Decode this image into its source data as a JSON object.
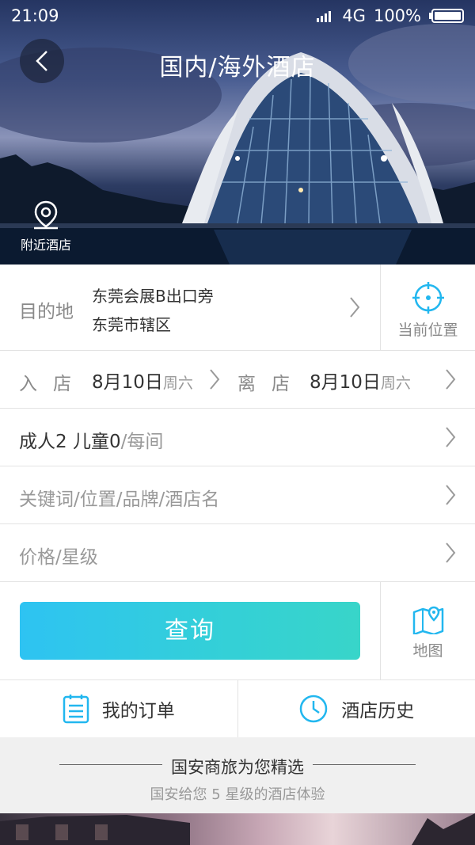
{
  "status": {
    "time": "21:09",
    "network": "4G",
    "battery": "100%"
  },
  "header": {
    "title": "国内/海外酒店",
    "nearby_label": "附近酒店"
  },
  "destination": {
    "label": "目的地",
    "line1": "东莞会展B出口旁",
    "line2": "东莞市辖区",
    "current_location": "当前位置"
  },
  "dates": {
    "checkin_label": "入店",
    "checkin_date": "8月10日",
    "checkin_weekday": "周六",
    "checkout_label": "离店",
    "checkout_date": "8月10日",
    "checkout_weekday": "周六"
  },
  "guests": {
    "main": "成人2 儿童0",
    "suffix": "/每间"
  },
  "keyword": {
    "placeholder": "关键词/位置/品牌/酒店名"
  },
  "price": {
    "placeholder": "价格/星级"
  },
  "search": {
    "label": "查询",
    "map_label": "地图"
  },
  "links": {
    "orders": "我的订单",
    "history": "酒店历史"
  },
  "recommend": {
    "title": "国安商旅为您精选",
    "subtitle": "国安给您 5 星级的酒店体验"
  }
}
